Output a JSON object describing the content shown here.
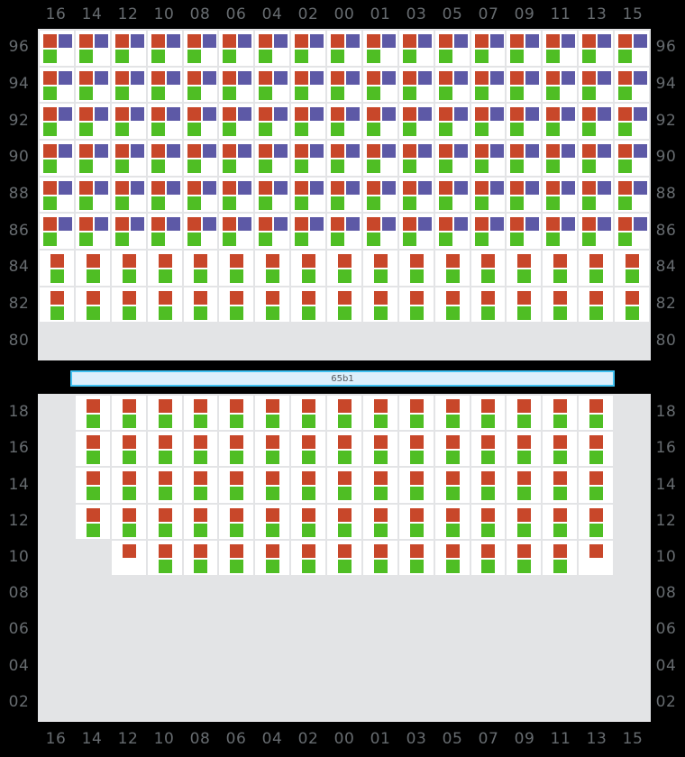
{
  "colors": {
    "red": "#c8472a",
    "purple": "#5d59a6",
    "green": "#4fbe24",
    "cell_on": "#ffffff",
    "cell_off": "#e3e4e6",
    "background": "#000000",
    "label": "#676c70",
    "bar_fill": "#dceffb",
    "bar_border": "#3fc0f0"
  },
  "columns": [
    "16",
    "14",
    "12",
    "10",
    "08",
    "06",
    "04",
    "02",
    "00",
    "01",
    "03",
    "05",
    "07",
    "09",
    "11",
    "13",
    "15"
  ],
  "mid_bar": {
    "label": "65b1"
  },
  "top_panel": {
    "row_labels": [
      "96",
      "94",
      "92",
      "90",
      "88",
      "86",
      "84",
      "82",
      "80"
    ],
    "rows": [
      {
        "label": "96",
        "markers": [
          "red",
          "purple",
          "green"
        ],
        "cells": [
          1,
          1,
          1,
          1,
          1,
          1,
          1,
          1,
          1,
          1,
          1,
          1,
          1,
          1,
          1,
          1,
          1
        ]
      },
      {
        "label": "94",
        "markers": [
          "red",
          "purple",
          "green"
        ],
        "cells": [
          1,
          1,
          1,
          1,
          1,
          1,
          1,
          1,
          1,
          1,
          1,
          1,
          1,
          1,
          1,
          1,
          1
        ]
      },
      {
        "label": "92",
        "markers": [
          "red",
          "purple",
          "green"
        ],
        "cells": [
          1,
          1,
          1,
          1,
          1,
          1,
          1,
          1,
          1,
          1,
          1,
          1,
          1,
          1,
          1,
          1,
          1
        ]
      },
      {
        "label": "90",
        "markers": [
          "red",
          "purple",
          "green"
        ],
        "cells": [
          1,
          1,
          1,
          1,
          1,
          1,
          1,
          1,
          1,
          1,
          1,
          1,
          1,
          1,
          1,
          1,
          1
        ]
      },
      {
        "label": "88",
        "markers": [
          "red",
          "purple",
          "green"
        ],
        "cells": [
          1,
          1,
          1,
          1,
          1,
          1,
          1,
          1,
          1,
          1,
          1,
          1,
          1,
          1,
          1,
          1,
          1
        ]
      },
      {
        "label": "86",
        "markers": [
          "red",
          "purple",
          "green"
        ],
        "cells": [
          1,
          1,
          1,
          1,
          1,
          1,
          1,
          1,
          1,
          1,
          1,
          1,
          1,
          1,
          1,
          1,
          1
        ]
      },
      {
        "label": "84",
        "markers": [
          "red",
          "green"
        ],
        "cells": [
          1,
          1,
          1,
          1,
          1,
          1,
          1,
          1,
          1,
          1,
          1,
          1,
          1,
          1,
          1,
          1,
          1
        ]
      },
      {
        "label": "82",
        "markers": [
          "red",
          "green"
        ],
        "cells": [
          1,
          1,
          1,
          1,
          1,
          1,
          1,
          1,
          1,
          1,
          1,
          1,
          1,
          1,
          1,
          1,
          1
        ]
      },
      {
        "label": "80",
        "markers": [],
        "cells": [
          0,
          0,
          0,
          0,
          0,
          0,
          0,
          0,
          0,
          0,
          0,
          0,
          0,
          0,
          0,
          0,
          0
        ]
      }
    ]
  },
  "bottom_panel": {
    "row_labels": [
      "18",
      "16",
      "14",
      "12",
      "10",
      "08",
      "06",
      "04",
      "02"
    ],
    "rows": [
      {
        "label": "18",
        "markers": [
          "red",
          "green"
        ],
        "cells": [
          0,
          1,
          1,
          1,
          1,
          1,
          1,
          1,
          1,
          1,
          1,
          1,
          1,
          1,
          1,
          1,
          0
        ]
      },
      {
        "label": "16",
        "markers": [
          "red",
          "green"
        ],
        "cells": [
          0,
          1,
          1,
          1,
          1,
          1,
          1,
          1,
          1,
          1,
          1,
          1,
          1,
          1,
          1,
          1,
          0
        ]
      },
      {
        "label": "14",
        "markers": [
          "red",
          "green"
        ],
        "cells": [
          0,
          1,
          1,
          1,
          1,
          1,
          1,
          1,
          1,
          1,
          1,
          1,
          1,
          1,
          1,
          1,
          0
        ]
      },
      {
        "label": "12",
        "markers": [
          "red",
          "green"
        ],
        "cells": [
          0,
          1,
          1,
          1,
          1,
          1,
          1,
          1,
          1,
          1,
          1,
          1,
          1,
          1,
          1,
          1,
          0
        ]
      },
      {
        "label": "10",
        "markers": [
          "red",
          "green"
        ],
        "cells": [
          0,
          0,
          2,
          1,
          1,
          1,
          1,
          1,
          1,
          1,
          1,
          1,
          1,
          1,
          1,
          2,
          0
        ]
      },
      {
        "label": "08",
        "markers": [],
        "cells": [
          0,
          0,
          0,
          0,
          0,
          0,
          0,
          0,
          0,
          0,
          0,
          0,
          0,
          0,
          0,
          0,
          0
        ]
      },
      {
        "label": "06",
        "markers": [],
        "cells": [
          0,
          0,
          0,
          0,
          0,
          0,
          0,
          0,
          0,
          0,
          0,
          0,
          0,
          0,
          0,
          0,
          0
        ]
      },
      {
        "label": "04",
        "markers": [],
        "cells": [
          0,
          0,
          0,
          0,
          0,
          0,
          0,
          0,
          0,
          0,
          0,
          0,
          0,
          0,
          0,
          0,
          0
        ]
      },
      {
        "label": "02",
        "markers": [],
        "cells": [
          0,
          0,
          0,
          0,
          0,
          0,
          0,
          0,
          0,
          0,
          0,
          0,
          0,
          0,
          0,
          0,
          0
        ]
      }
    ]
  }
}
